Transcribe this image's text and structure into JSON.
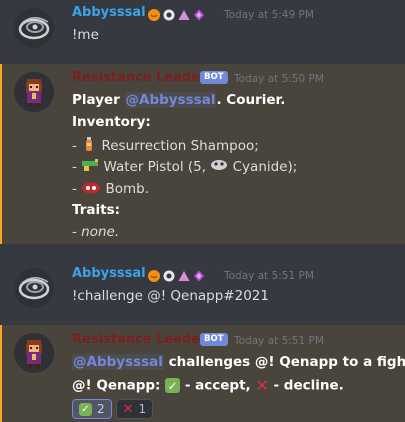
{
  "colors": {
    "background": "#36393f",
    "highlight_bg": "#49443c",
    "highlight_bar": "#faa61a",
    "user_name": "#3ba3e8",
    "bot_name": "#7a1f1f",
    "mention": "#7289da",
    "bot_badge": "#7289da"
  },
  "messages": [
    {
      "author": "Abbysssal",
      "timestamp": "Today at 5:49 PM",
      "badges": [
        "heart-face-icon",
        "eye-icon",
        "triangle-icon",
        "gem-icon"
      ],
      "text": "!me"
    },
    {
      "author": "Resistance Leader",
      "bot_tag": "BOT",
      "timestamp": "Today at 5:50 PM",
      "player_prefix": "Player ",
      "player_mention": "@Abbysssal",
      "player_suffix": ". Courier.",
      "inventory_label": "Inventory:",
      "items": [
        {
          "bullet": "- ",
          "icon": "potion-icon",
          "text": " Resurrection Shampoo;"
        },
        {
          "bullet": "- ",
          "icon": "water-pistol-icon",
          "text": " Water Pistol (5, ",
          "sub_icon": "cyanide-icon",
          "sub_text": " Cyanide);"
        },
        {
          "bullet": "- ",
          "icon": "bomb-icon",
          "text": " Bomb."
        }
      ],
      "traits_label": "Traits:",
      "traits_text": "- none.",
      "traits_bullet": "- ",
      "traits_value": "none."
    },
    {
      "author": "Abbysssal",
      "timestamp": "Today at 5:51 PM",
      "badges": [
        "heart-face-icon",
        "eye-icon",
        "triangle-icon",
        "gem-icon"
      ],
      "text": "!challenge @! Qenapp#2021"
    },
    {
      "author": "Resistance Leader",
      "bot_tag": "BOT",
      "timestamp": "Today at 5:51 PM",
      "line1_mention": "@Abbysssal",
      "line1_text": " challenges @! Qenapp to a fight!",
      "line2_prefix": "@! Qenapp: ",
      "line2_accept": " - accept, ",
      "line2_decline": " - decline.",
      "reactions": [
        {
          "emoji": "check-icon",
          "count": "2"
        },
        {
          "emoji": "cross-icon",
          "count": "1"
        }
      ]
    }
  ]
}
